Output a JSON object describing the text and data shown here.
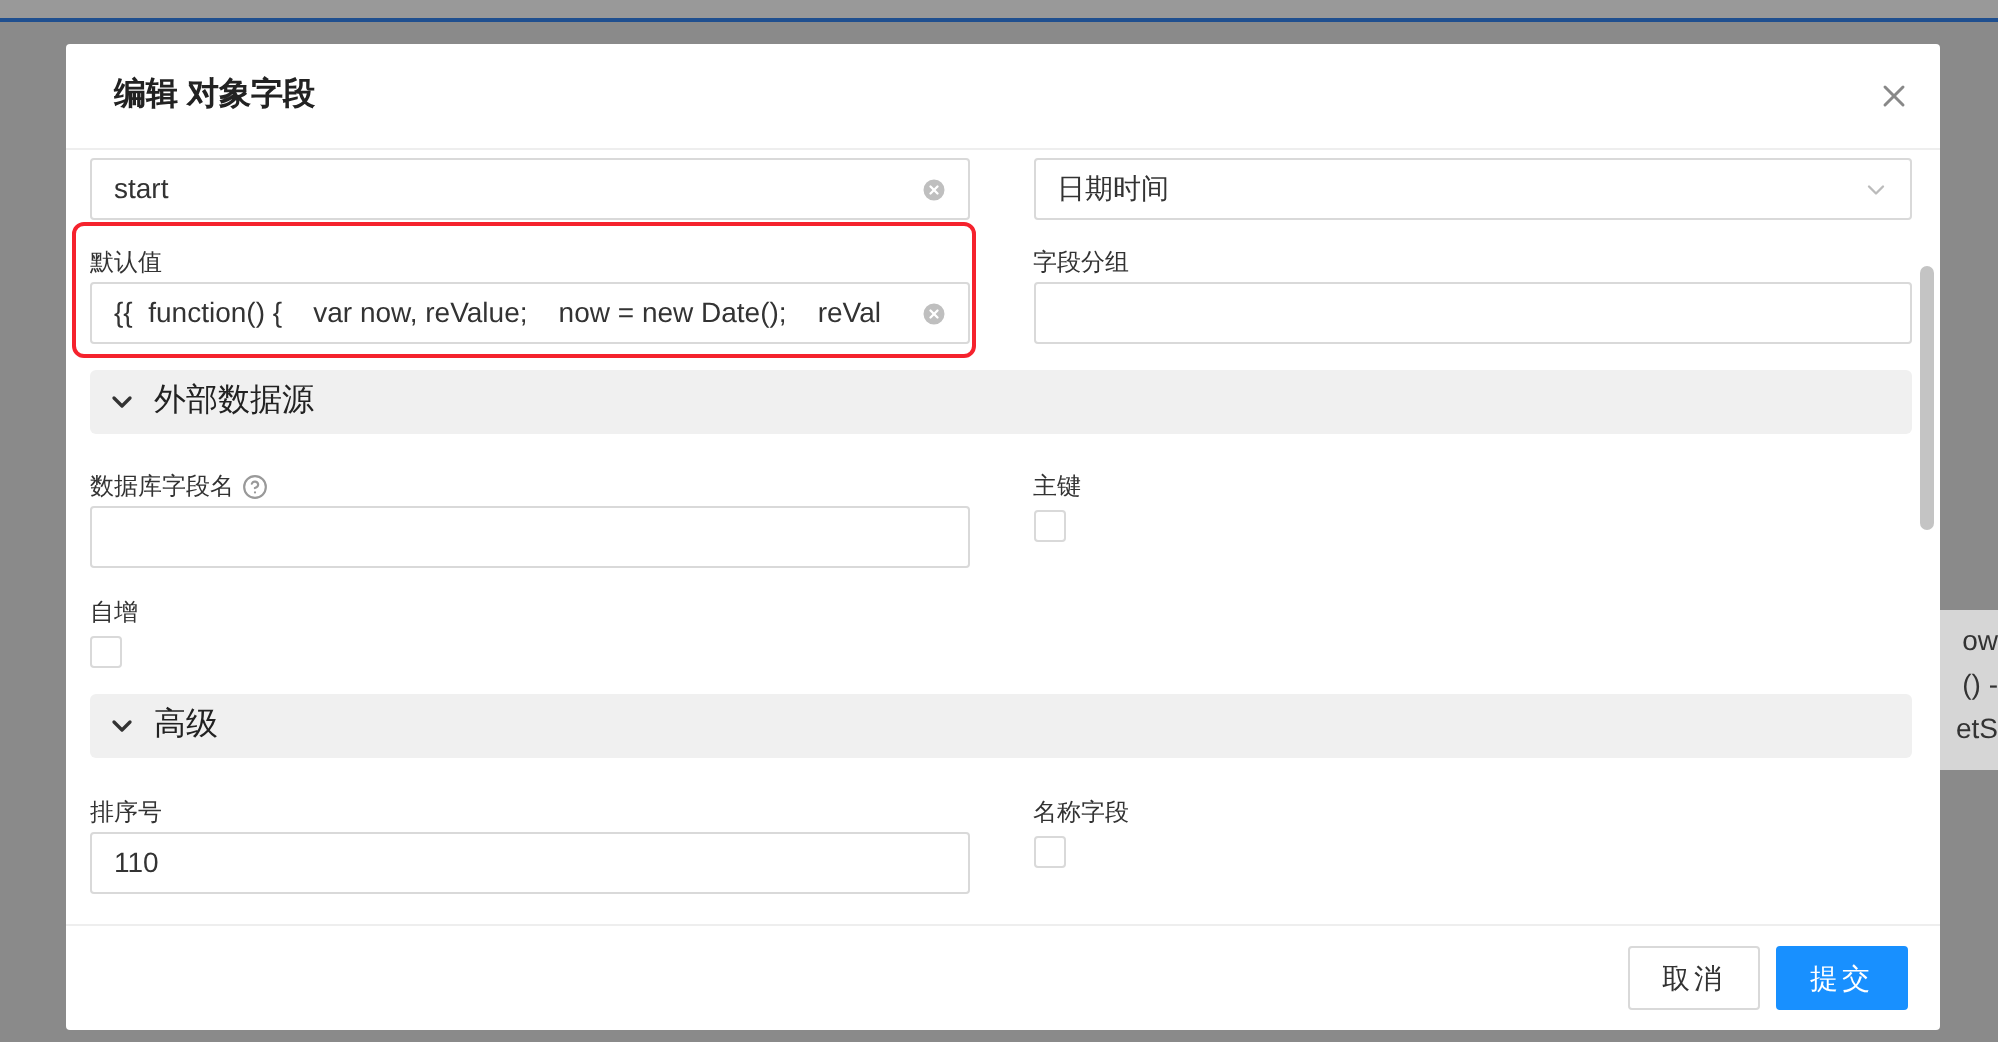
{
  "background_text": [
    "ow",
    "() -",
    "etS"
  ],
  "dialog": {
    "title": "编辑 对象字段",
    "blocks": [
      {
        "kind": "row",
        "cells": [
          {
            "kind": "text",
            "value": "start",
            "clearable": true
          },
          {
            "kind": "select",
            "value": "日期时间"
          }
        ]
      },
      {
        "kind": "row",
        "cells": [
          {
            "kind": "text",
            "label": "默认值",
            "value": "{{  function() {    var now, reValue;    now = new Date();    reVal",
            "clearable": true,
            "highlighted": true
          },
          {
            "kind": "text",
            "label": "字段分组"
          }
        ]
      },
      {
        "kind": "section",
        "title": "外部数据源",
        "expanded": true
      },
      {
        "kind": "row",
        "cells": [
          {
            "kind": "text",
            "label": "数据库字段名",
            "help": true
          },
          {
            "kind": "checkbox",
            "label": "主键",
            "checked": false
          }
        ]
      },
      {
        "kind": "row",
        "cells": [
          {
            "kind": "checkbox",
            "label": "自增",
            "checked": false
          }
        ]
      },
      {
        "kind": "section",
        "title": "高级",
        "expanded": true
      },
      {
        "kind": "row",
        "cells": [
          {
            "kind": "text",
            "label": "排序号",
            "value": "110"
          },
          {
            "kind": "checkbox",
            "label": "名称字段",
            "checked": false
          }
        ]
      }
    ],
    "buttons": [
      {
        "label": "取消",
        "kind": "default"
      },
      {
        "label": "提交",
        "kind": "primary"
      }
    ]
  }
}
